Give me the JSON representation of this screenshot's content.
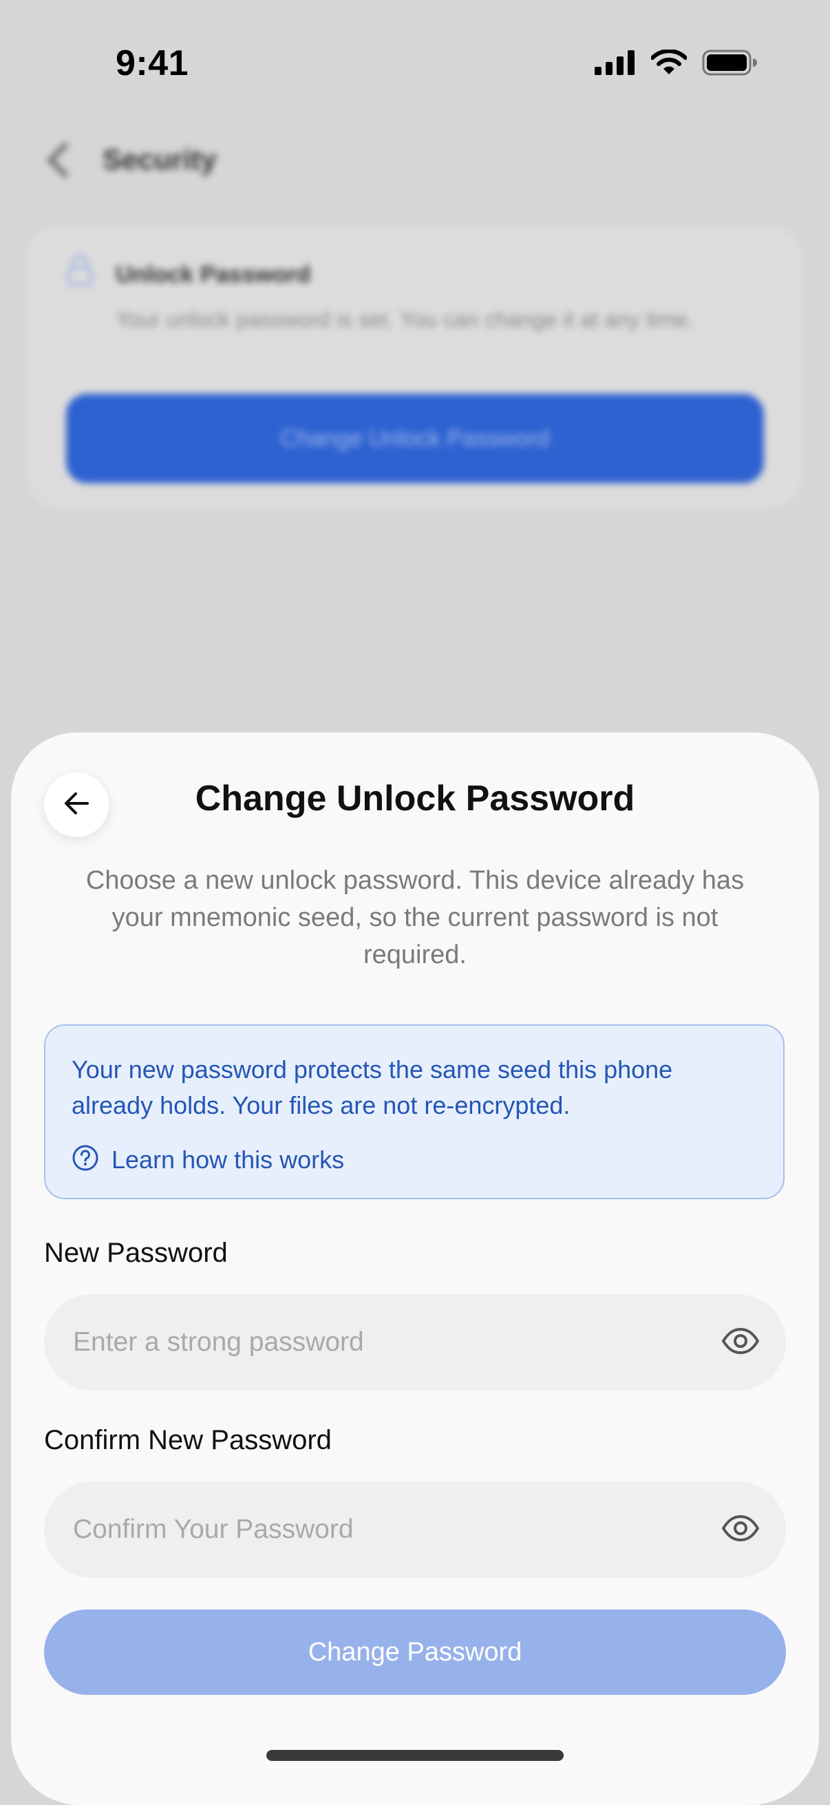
{
  "status_bar": {
    "time": "9:41",
    "icons": [
      "cellular-signal-icon",
      "wifi-icon",
      "battery-icon"
    ]
  },
  "background": {
    "nav_title": "Security",
    "card": {
      "icon": "lock-icon",
      "title": "Unlock Password",
      "description": "Your unlock password is set. You can change it at any time.",
      "button_label": "Change Unlock Password"
    }
  },
  "sheet": {
    "back_icon": "arrow-left-icon",
    "title": "Change Unlock Password",
    "subtitle": "Choose a new unlock password. This device already has your mnemonic seed, so the current password is not required.",
    "info": {
      "text": "Your new password protects the same seed this phone already holds. Your files are not re-encrypted.",
      "link_icon": "question-circle-icon",
      "link_label": "Learn how this works"
    },
    "new_password": {
      "label": "New Password",
      "placeholder": "Enter a strong password",
      "value": "",
      "toggle_icon": "eye-icon"
    },
    "confirm_password": {
      "label": "Confirm New Password",
      "placeholder": "Confirm Your Password",
      "value": "",
      "toggle_icon": "eye-icon"
    },
    "submit_label": "Change Password"
  },
  "colors": {
    "accent": "#2e62d1",
    "accent_disabled": "#97b1ea",
    "info_background": "#e8effc",
    "info_text": "#2456b5",
    "sheet_background": "#f9f9f9"
  }
}
